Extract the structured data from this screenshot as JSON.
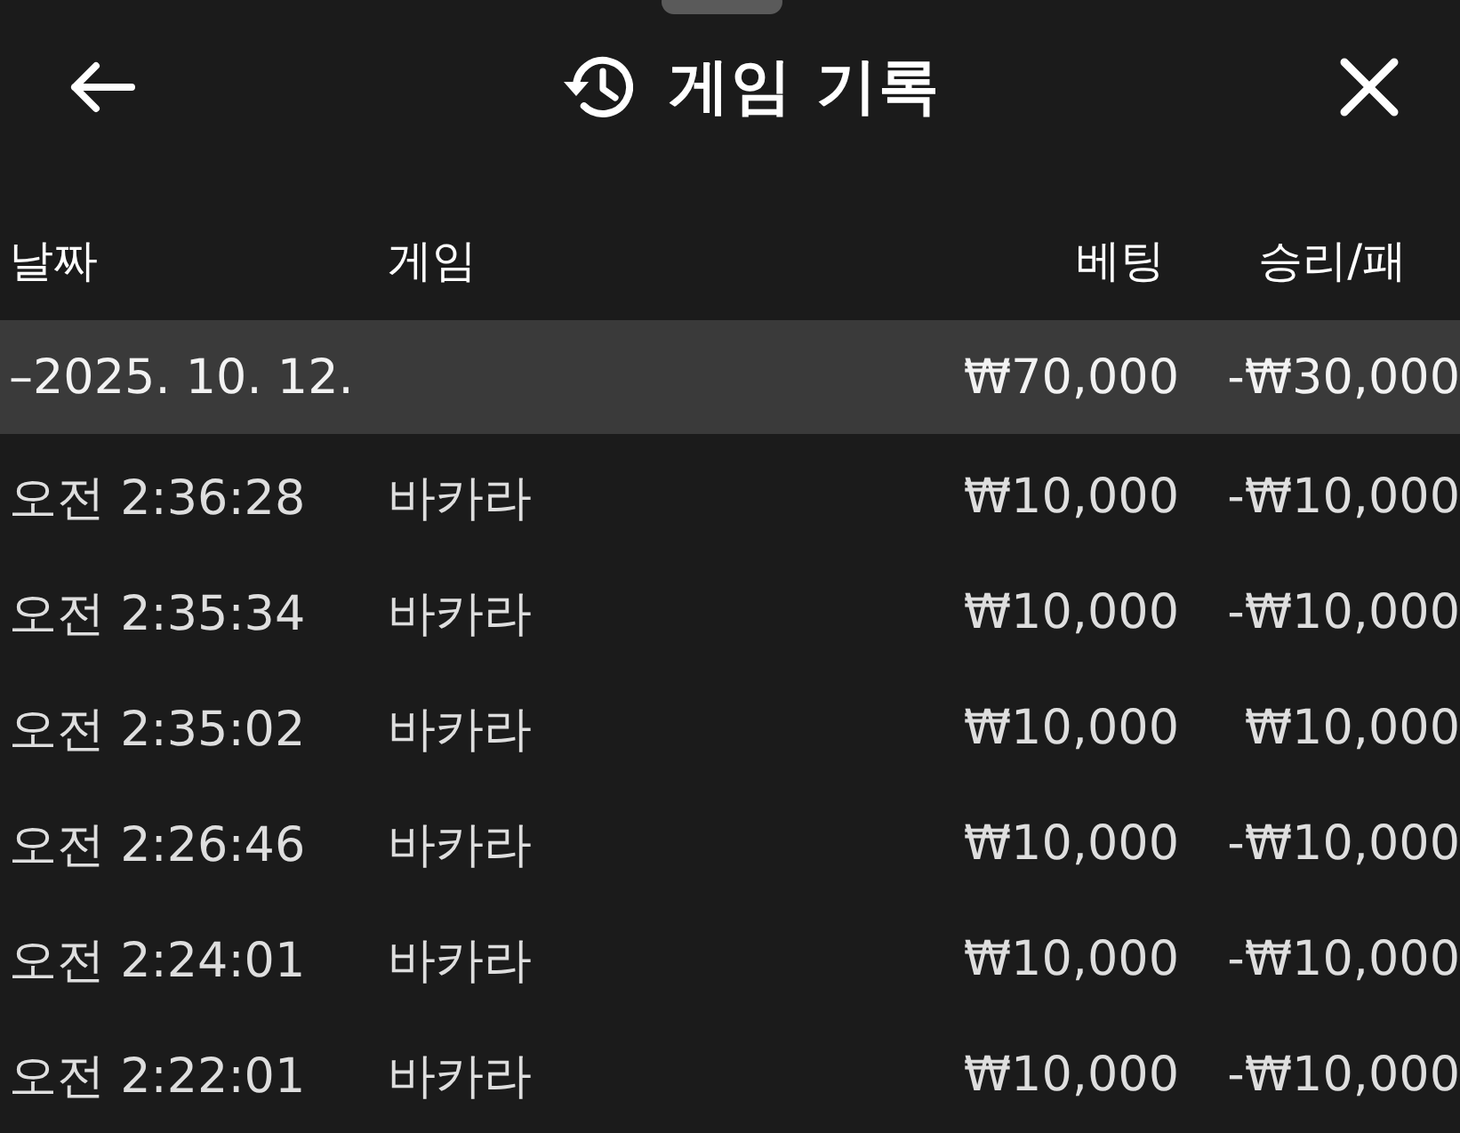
{
  "header": {
    "title": "게임 기록"
  },
  "table": {
    "columns": [
      "날짜",
      "게임",
      "베팅",
      "승리/패"
    ],
    "groups": [
      {
        "label": "–2025. 10. 12.",
        "bet": "₩70,000",
        "result": "-₩30,000",
        "rows": [
          {
            "time": "오전 2:36:28",
            "game": "바카라",
            "bet": "₩10,000",
            "result": "-₩10,000"
          },
          {
            "time": "오전 2:35:34",
            "game": "바카라",
            "bet": "₩10,000",
            "result": "-₩10,000"
          },
          {
            "time": "오전 2:35:02",
            "game": "바카라",
            "bet": "₩10,000",
            "result": "₩10,000"
          },
          {
            "time": "오전 2:26:46",
            "game": "바카라",
            "bet": "₩10,000",
            "result": "-₩10,000"
          },
          {
            "time": "오전 2:24:01",
            "game": "바카라",
            "bet": "₩10,000",
            "result": "-₩10,000"
          },
          {
            "time": "오전 2:22:01",
            "game": "바카라",
            "bet": "₩10,000",
            "result": "-₩10,000"
          }
        ]
      }
    ]
  }
}
